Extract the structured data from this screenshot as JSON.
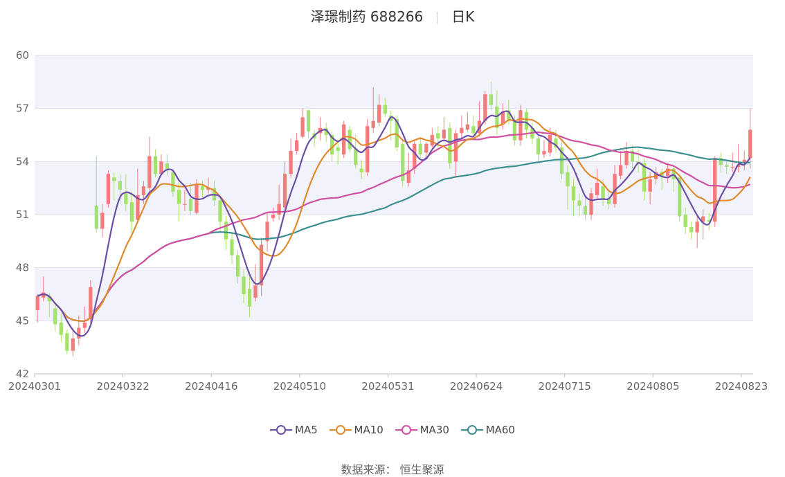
{
  "title": {
    "name": "泽璟制药 688266",
    "period": "日K"
  },
  "source": {
    "label": "数据来源：",
    "value": "恒生聚源"
  },
  "colors": {
    "up": "#f47b7b",
    "down": "#a4e36b",
    "MA5": "#6b4ea6",
    "MA10": "#e08a2e",
    "MA30": "#d14fa0",
    "MA60": "#3d8f8f",
    "band": "#f2f3fa",
    "grid": "#dde0ea"
  },
  "chart_data": {
    "type": "candlestick",
    "ylim": [
      42,
      60
    ],
    "yticks": [
      42,
      45,
      48,
      51,
      54,
      57,
      60
    ],
    "xtick_labels": [
      "20240301",
      "20240322",
      "20240416",
      "20240510",
      "20240531",
      "20240624",
      "20240715",
      "20240805",
      "20240823"
    ],
    "xtick_indices": [
      0,
      15,
      30,
      45,
      60,
      75,
      90,
      105,
      120
    ],
    "legend": [
      "MA5",
      "MA10",
      "MA30",
      "MA60"
    ],
    "candles": [
      [
        45.6,
        46.4,
        46.5,
        44.9
      ],
      [
        46.3,
        46.6,
        47.5,
        46.1
      ],
      [
        46.4,
        46.1,
        46.6,
        45.2
      ],
      [
        45.7,
        44.8,
        45.9,
        44.4
      ],
      [
        44.9,
        44.2,
        45.4,
        43.8
      ],
      [
        44.3,
        43.3,
        44.5,
        43.1
      ],
      [
        43.3,
        44.0,
        44.6,
        43.0
      ],
      [
        44.0,
        44.6,
        45.3,
        43.6
      ],
      [
        44.6,
        44.9,
        45.8,
        44.3
      ],
      [
        45.1,
        46.9,
        47.3,
        44.8
      ],
      [
        51.5,
        50.2,
        54.3,
        50.0
      ],
      [
        50.2,
        51.1,
        51.6,
        49.7
      ],
      [
        51.6,
        53.3,
        53.5,
        51.4
      ],
      [
        53.1,
        52.9,
        53.4,
        51.8
      ],
      [
        52.9,
        52.4,
        53.3,
        51.6
      ],
      [
        52.2,
        51.6,
        53.3,
        51.2
      ],
      [
        51.7,
        50.6,
        52.3,
        50.0
      ],
      [
        50.7,
        52.1,
        53.6,
        50.5
      ],
      [
        52.1,
        52.6,
        52.9,
        51.6
      ],
      [
        52.5,
        54.3,
        55.4,
        52.2
      ],
      [
        54.3,
        53.3,
        54.7,
        53.1
      ],
      [
        53.3,
        54.0,
        54.4,
        53.3
      ],
      [
        53.9,
        53.5,
        54.4,
        53.2
      ],
      [
        53.4,
        52.3,
        53.6,
        52.0
      ],
      [
        52.4,
        51.6,
        52.8,
        50.6
      ],
      [
        51.6,
        51.6,
        52.4,
        51.2
      ],
      [
        51.9,
        51.2,
        52.8,
        51.0
      ],
      [
        51.1,
        52.7,
        53.0,
        51.0
      ],
      [
        52.6,
        52.4,
        52.9,
        52.0
      ],
      [
        52.4,
        52.5,
        53.1,
        52.2
      ],
      [
        52.5,
        51.8,
        52.9,
        51.5
      ],
      [
        51.8,
        50.6,
        52.0,
        50.0
      ],
      [
        50.6,
        49.6,
        50.9,
        49.0
      ],
      [
        49.6,
        48.7,
        50.0,
        48.2
      ],
      [
        48.7,
        47.5,
        49.0,
        47.1
      ],
      [
        47.5,
        46.5,
        47.9,
        46.0
      ],
      [
        46.8,
        45.8,
        47.8,
        45.2
      ],
      [
        46.3,
        47.0,
        48.2,
        46.1
      ],
      [
        47.0,
        49.3,
        49.7,
        46.4
      ],
      [
        49.5,
        50.6,
        51.1,
        48.9
      ],
      [
        50.8,
        51.0,
        51.4,
        50.6
      ],
      [
        51.0,
        51.6,
        52.7,
        50.7
      ],
      [
        51.4,
        53.3,
        54.0,
        51.2
      ],
      [
        53.3,
        54.6,
        55.3,
        53.1
      ],
      [
        54.6,
        55.2,
        55.6,
        54.4
      ],
      [
        55.4,
        56.5,
        57.0,
        55.3
      ],
      [
        56.9,
        55.7,
        56.9,
        55.3
      ],
      [
        55.6,
        55.3,
        55.8,
        54.8
      ],
      [
        55.6,
        55.9,
        56.5,
        55.2
      ],
      [
        55.9,
        55.5,
        56.2,
        55.1
      ],
      [
        55.5,
        54.4,
        55.7,
        54.0
      ],
      [
        54.8,
        54.6,
        55.0,
        53.8
      ],
      [
        54.4,
        56.1,
        56.3,
        54.2
      ],
      [
        55.8,
        54.7,
        56.0,
        54.5
      ],
      [
        54.7,
        53.8,
        55.5,
        53.6
      ],
      [
        53.6,
        53.4,
        54.1,
        53.0
      ],
      [
        53.4,
        56.0,
        56.4,
        53.2
      ],
      [
        55.9,
        56.3,
        58.2,
        55.6
      ],
      [
        56.2,
        57.2,
        57.8,
        56.0
      ],
      [
        57.2,
        56.7,
        57.6,
        56.5
      ],
      [
        56.6,
        56.3,
        56.9,
        55.2
      ],
      [
        56.4,
        54.8,
        56.6,
        54.6
      ],
      [
        55.0,
        52.9,
        55.2,
        52.6
      ],
      [
        52.8,
        53.5,
        54.5,
        52.6
      ],
      [
        53.6,
        55.0,
        55.2,
        53.3
      ],
      [
        55.0,
        54.4,
        55.4,
        54.2
      ],
      [
        54.5,
        55.0,
        55.1,
        54.3
      ],
      [
        54.9,
        55.5,
        55.9,
        54.8
      ],
      [
        55.6,
        55.3,
        56.0,
        54.8
      ],
      [
        55.3,
        55.8,
        56.5,
        55.1
      ],
      [
        55.9,
        53.9,
        56.2,
        53.6
      ],
      [
        54.0,
        55.6,
        55.8,
        53.1
      ],
      [
        55.6,
        55.9,
        56.6,
        55.2
      ],
      [
        55.8,
        56.1,
        56.8,
        55.7
      ],
      [
        56.0,
        55.6,
        56.6,
        55.2
      ],
      [
        55.6,
        56.3,
        57.4,
        55.4
      ],
      [
        56.3,
        57.8,
        58.0,
        56.1
      ],
      [
        57.8,
        57.2,
        58.5,
        56.9
      ],
      [
        57.1,
        55.9,
        58.0,
        55.5
      ],
      [
        56.1,
        56.8,
        57.3,
        55.8
      ],
      [
        56.9,
        56.3,
        57.5,
        56.1
      ],
      [
        56.3,
        55.2,
        56.6,
        54.9
      ],
      [
        55.2,
        56.9,
        57.2,
        54.9
      ],
      [
        56.8,
        55.8,
        57.0,
        55.3
      ],
      [
        55.9,
        55.3,
        56.2,
        55.0
      ],
      [
        55.3,
        54.4,
        55.5,
        54.0
      ],
      [
        54.4,
        54.6,
        55.2,
        54.2
      ],
      [
        54.5,
        55.5,
        55.9,
        54.3
      ],
      [
        55.3,
        54.8,
        55.8,
        54.5
      ],
      [
        54.8,
        53.3,
        55.1,
        53.0
      ],
      [
        53.4,
        52.6,
        53.8,
        51.3
      ],
      [
        52.6,
        51.8,
        53.0,
        50.9
      ],
      [
        51.8,
        51.5,
        52.2,
        50.9
      ],
      [
        51.5,
        51.0,
        52.0,
        50.7
      ],
      [
        51.0,
        52.2,
        52.5,
        50.7
      ],
      [
        52.1,
        52.8,
        53.6,
        51.9
      ],
      [
        52.6,
        51.9,
        53.0,
        51.5
      ],
      [
        51.9,
        51.6,
        52.3,
        51.3
      ],
      [
        51.6,
        53.3,
        53.8,
        51.4
      ],
      [
        53.2,
        53.8,
        54.6,
        53.0
      ],
      [
        53.8,
        54.6,
        55.1,
        53.6
      ],
      [
        54.6,
        54.0,
        54.9,
        53.6
      ],
      [
        54.0,
        53.9,
        54.7,
        53.4
      ],
      [
        53.9,
        52.3,
        54.2,
        51.8
      ],
      [
        52.3,
        53.0,
        53.4,
        51.6
      ],
      [
        53.0,
        53.4,
        53.7,
        52.7
      ],
      [
        53.4,
        53.2,
        53.6,
        52.4
      ],
      [
        53.2,
        53.6,
        53.8,
        52.8
      ],
      [
        53.6,
        53.0,
        53.8,
        52.3
      ],
      [
        53.1,
        50.9,
        53.3,
        50.6
      ],
      [
        51.0,
        50.3,
        51.4,
        49.9
      ],
      [
        50.3,
        50.0,
        50.6,
        49.6
      ],
      [
        50.0,
        50.6,
        50.9,
        49.1
      ],
      [
        50.6,
        50.9,
        51.3,
        49.6
      ],
      [
        50.7,
        50.6,
        51.1,
        50.1
      ],
      [
        50.6,
        54.2,
        54.3,
        50.3
      ],
      [
        54.2,
        53.8,
        54.5,
        53.4
      ],
      [
        53.8,
        53.7,
        54.1,
        53.3
      ],
      [
        53.7,
        53.7,
        54.5,
        53.4
      ],
      [
        53.7,
        53.8,
        55.0,
        53.4
      ],
      [
        53.9,
        54.1,
        54.6,
        53.5
      ],
      [
        54.2,
        55.8,
        57.0,
        53.6
      ]
    ]
  }
}
